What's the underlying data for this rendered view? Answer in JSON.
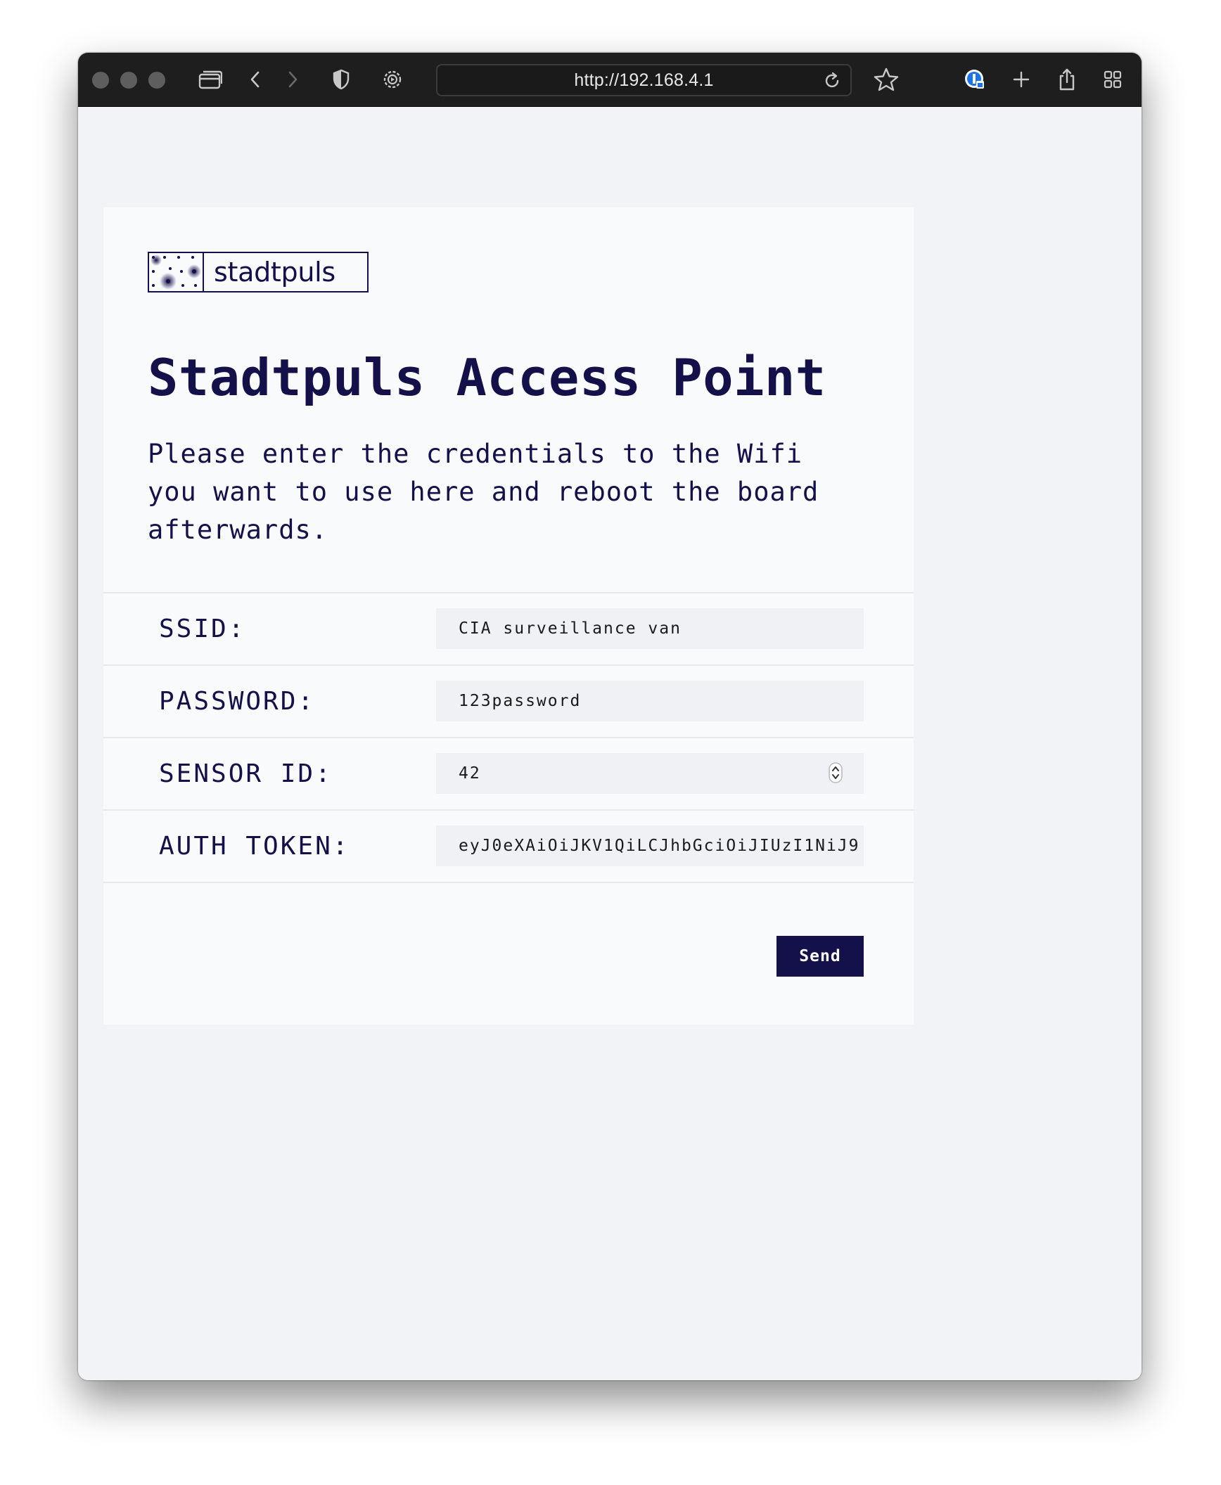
{
  "browser": {
    "url": "http://192.168.4.1"
  },
  "page": {
    "logo_text": "stadtpuls",
    "title": "Stadtpuls Access Point",
    "description": "Please enter the credentials to the Wifi you want to use here and reboot the board afterwards."
  },
  "form": {
    "fields": [
      {
        "label": "SSID:",
        "value": "CIA surveillance van"
      },
      {
        "label": "PASSWORD:",
        "value": "123password"
      },
      {
        "label": "SENSOR ID:",
        "value": "42"
      },
      {
        "label": "AUTH TOKEN:",
        "value": "eyJ0eXAiOiJKV1QiLCJhbGciOiJIUzI1NiJ9"
      }
    ],
    "submit_label": "Send"
  },
  "colors": {
    "brand": "#13104a",
    "toolbar": "#1e1e1e",
    "page_bg": "#f2f3f7",
    "card_bg": "#f9fafc",
    "field_bg": "#f0f1f5"
  }
}
